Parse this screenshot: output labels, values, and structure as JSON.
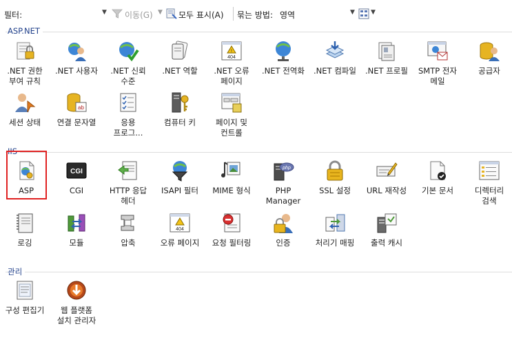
{
  "toolbar": {
    "filter_label": "필터:",
    "filter_value": "",
    "go_label": "이동(G)",
    "show_all_label": "모두 표시(A)",
    "group_by_label": "묶는 방법:",
    "group_by_value": "영역"
  },
  "groups": [
    {
      "title": "ASP.NET",
      "items": [
        {
          "label": ".NET 권한\n부여 규칙",
          "icon": "authorization-rules-icon"
        },
        {
          "label": ".NET 사용자",
          "icon": "net-users-icon"
        },
        {
          "label": ".NET 신뢰\n수준",
          "icon": "trust-levels-icon"
        },
        {
          "label": ".NET 역할",
          "icon": "net-roles-icon"
        },
        {
          "label": ".NET 오류\n페이지",
          "icon": "error-pages-404-icon"
        },
        {
          "label": ".NET 전역화",
          "icon": "globalization-icon"
        },
        {
          "label": ".NET 컴파일",
          "icon": "compilation-icon"
        },
        {
          "label": ".NET 프로필",
          "icon": "profile-icon"
        },
        {
          "label": "SMTP 전자\n메일",
          "icon": "smtp-email-icon"
        },
        {
          "label": "공급자",
          "icon": "providers-icon"
        },
        {
          "label": "세션 상태",
          "icon": "session-state-icon"
        },
        {
          "label": "연결 문자열",
          "icon": "connection-strings-icon"
        },
        {
          "label": "응용\n프로그...",
          "icon": "application-settings-icon"
        },
        {
          "label": "컴퓨터 키",
          "icon": "machine-key-icon"
        },
        {
          "label": "페이지 및\n컨트롤",
          "icon": "pages-controls-icon"
        }
      ]
    },
    {
      "title": "IIS",
      "items": [
        {
          "label": "ASP",
          "icon": "asp-icon"
        },
        {
          "label": "CGI",
          "icon": "cgi-icon"
        },
        {
          "label": "HTTP 응답\n헤더",
          "icon": "http-response-headers-icon"
        },
        {
          "label": "ISAPI 필터",
          "icon": "isapi-filters-icon"
        },
        {
          "label": "MIME 형식",
          "icon": "mime-types-icon"
        },
        {
          "label": "PHP\nManager",
          "icon": "php-manager-icon"
        },
        {
          "label": "SSL 설정",
          "icon": "ssl-lock-icon"
        },
        {
          "label": "URL 재작성",
          "icon": "url-rewrite-icon"
        },
        {
          "label": "기본 문서",
          "icon": "default-document-icon"
        },
        {
          "label": "디렉터리\n검색",
          "icon": "directory-browsing-icon"
        },
        {
          "label": "로깅",
          "icon": "logging-icon"
        },
        {
          "label": "모듈",
          "icon": "modules-icon"
        },
        {
          "label": "압축",
          "icon": "compression-icon"
        },
        {
          "label": "오류 페이지",
          "icon": "error-pages-icon"
        },
        {
          "label": "요청 필터링",
          "icon": "request-filtering-icon"
        },
        {
          "label": "인증",
          "icon": "authentication-icon"
        },
        {
          "label": "처리기 매핑",
          "icon": "handler-mappings-icon"
        },
        {
          "label": "출력 캐시",
          "icon": "output-caching-icon"
        }
      ]
    },
    {
      "title": "관리",
      "items": [
        {
          "label": "구성 편집기",
          "icon": "configuration-editor-icon"
        },
        {
          "label": "웹 플랫폼\n설치 관리자",
          "icon": "web-platform-installer-icon"
        }
      ]
    }
  ],
  "colors": {
    "group_title": "#1f3f8a",
    "highlight": "#e02020"
  }
}
